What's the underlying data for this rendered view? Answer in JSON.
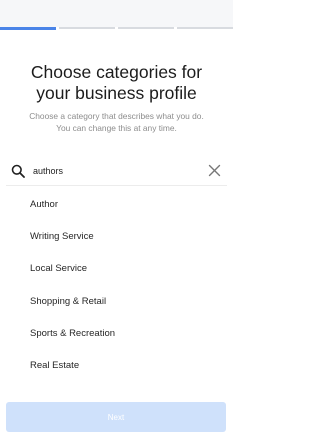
{
  "progress": {
    "total_steps": 4,
    "current_step": 1
  },
  "header": {
    "title_line1": "Choose categories for",
    "title_line2": "your business profile",
    "subtitle_line1": "Choose a category that describes what you do.",
    "subtitle_line2": "You can change this at any time."
  },
  "search": {
    "value": "authors",
    "icon": "search-icon",
    "clear_icon": "close-icon"
  },
  "results": [
    "Author",
    "Writing Service",
    "Local Service",
    "Shopping & Retail",
    "Sports & Recreation",
    "Real Estate"
  ],
  "footer": {
    "next_label": "Next"
  },
  "colors": {
    "accent": "#4a84e8",
    "button_disabled": "#cfe1fb"
  }
}
